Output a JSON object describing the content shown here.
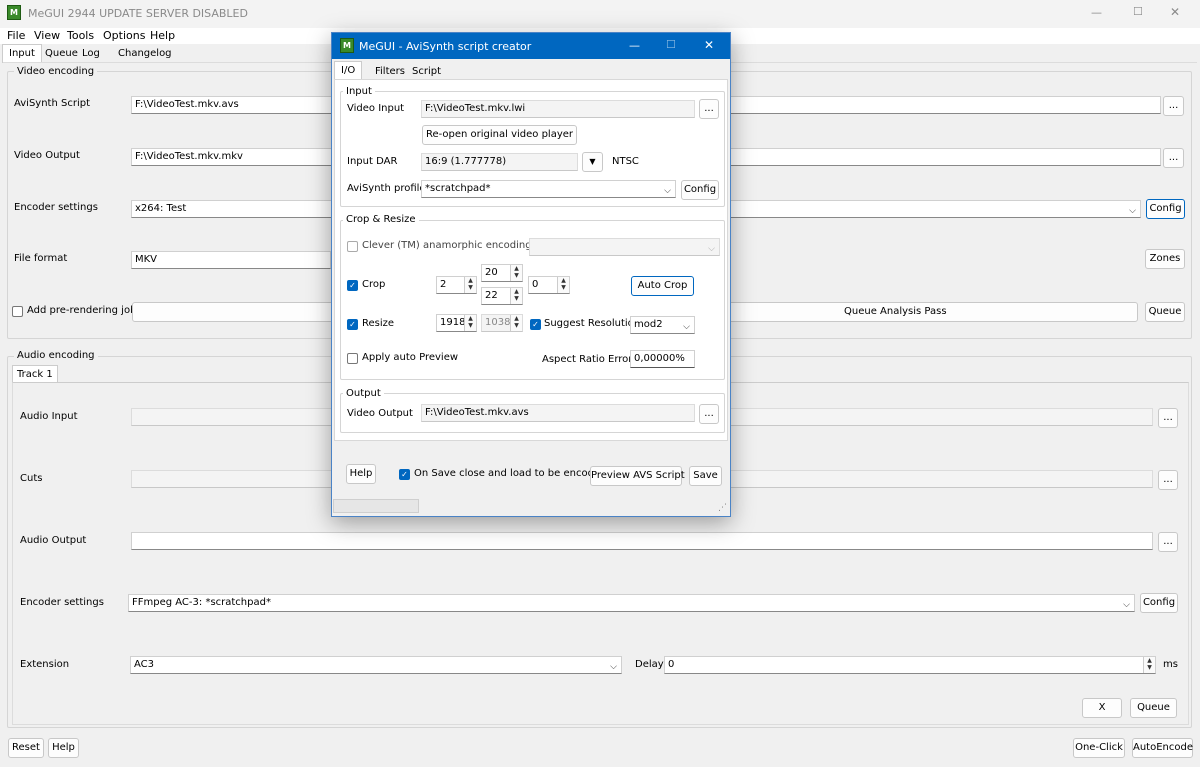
{
  "main_window": {
    "title": "MeGUI 2944 UPDATE SERVER DISABLED",
    "app_icon_text": "M",
    "window_controls": {
      "minimize": "—",
      "maximize": "☐",
      "close": "✕"
    },
    "menu": [
      "File",
      "View",
      "Tools",
      "Options",
      "Help"
    ],
    "tabs": [
      "Input",
      "Queue",
      "Log",
      "Changelog"
    ],
    "video_encoding": {
      "group_label": "Video encoding",
      "avisynth_script_label": "AviSynth Script",
      "avisynth_script_value": "F:\\VideoTest.mkv.avs",
      "video_output_label": "Video Output",
      "video_output_value": "F:\\VideoTest.mkv.mkv",
      "encoder_settings_label": "Encoder settings",
      "encoder_settings_value": "x264: Test",
      "file_format_label": "File format",
      "file_format_value": "MKV",
      "add_prerendering_label": "Add pre-rendering job",
      "browse_label": "...",
      "config_label": "Config",
      "zones_label": "Zones",
      "queue_analysis_label": "Queue Analysis Pass",
      "queue_label": "Queue"
    },
    "audio_encoding": {
      "group_label": "Audio encoding",
      "track_tab": "Track 1",
      "audio_input_label": "Audio Input",
      "audio_input_value": "",
      "cuts_label": "Cuts",
      "cuts_value": "",
      "audio_output_label": "Audio Output",
      "audio_output_value": "",
      "encoder_settings_label": "Encoder settings",
      "encoder_settings_value": "FFmpeg AC-3: *scratchpad*",
      "extension_label": "Extension",
      "extension_value": "AC3",
      "delay_label": "Delay",
      "delay_value": "0",
      "delay_unit": "ms",
      "browse_label": "...",
      "config_label": "Config",
      "x_label": "X",
      "queue_label": "Queue"
    },
    "bottom": {
      "reset": "Reset",
      "help": "Help",
      "one_click": "One-Click",
      "autoencode": "AutoEncode"
    }
  },
  "dialog": {
    "title": "MeGUI - AviSynth script creator",
    "app_icon_text": "M",
    "window_controls": {
      "minimize": "—",
      "maximize": "☐",
      "close": "✕"
    },
    "tabs": [
      "I/O",
      "Filters",
      "Script"
    ],
    "input": {
      "group_label": "Input",
      "video_input_label": "Video Input",
      "video_input_value": "F:\\VideoTest.mkv.lwi",
      "browse_label": "...",
      "reopen_label": "Re-open original video player",
      "input_dar_label": "Input DAR",
      "input_dar_value": "16:9 (1.777778)",
      "ntsc_label": "NTSC",
      "avisynth_profile_label": "AviSynth profile",
      "avisynth_profile_value": "*scratchpad*",
      "config_label": "Config"
    },
    "crop_resize": {
      "group_label": "Crop & Resize",
      "clever_label": "Clever (TM) anamorphic encoding:",
      "crop_label": "Crop",
      "crop_left": "2",
      "crop_top": "20",
      "crop_bottom": "22",
      "crop_right": "0",
      "auto_crop_label": "Auto Crop",
      "resize_label": "Resize",
      "resize_width": "1918",
      "resize_height": "1038",
      "suggest_resolution_label": "Suggest Resolution",
      "mod_value": "mod2",
      "apply_preview_label": "Apply auto Preview",
      "aspect_error_label": "Aspect Ratio Error",
      "aspect_error_value": "0,00000%"
    },
    "output": {
      "group_label": "Output",
      "video_output_label": "Video Output",
      "video_output_value": "F:\\VideoTest.mkv.avs",
      "browse_label": "..."
    },
    "bottom": {
      "help_label": "Help",
      "on_save_label": "On Save close and load to be encoded",
      "preview_label": "Preview AVS Script",
      "save_label": "Save"
    }
  }
}
